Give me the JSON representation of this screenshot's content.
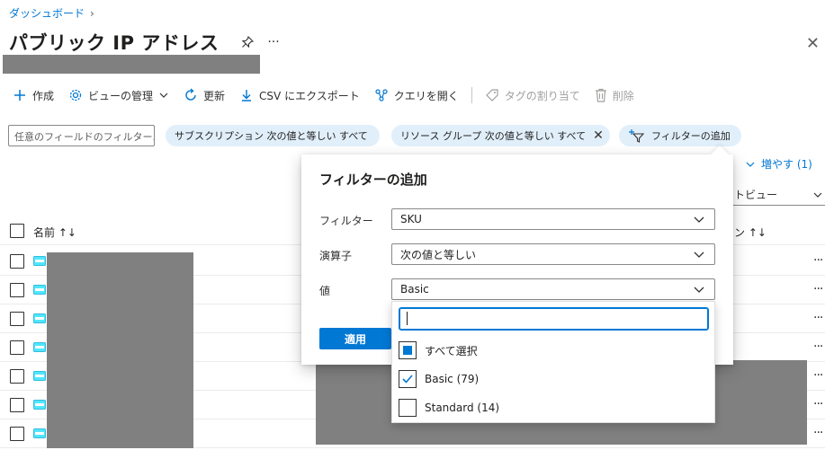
{
  "breadcrumb": {
    "item": "ダッシュボード",
    "separator": "›"
  },
  "page": {
    "title": "パブリック IP アドレス",
    "more": "···",
    "close": "✕"
  },
  "toolbar": {
    "create": "作成",
    "manage_view": "ビューの管理",
    "refresh": "更新",
    "export_csv": "CSV にエクスポート",
    "open_query": "クエリを開く",
    "assign_tags": "タグの割り当て",
    "delete": "削除"
  },
  "filters": {
    "search_placeholder": "任意のフィールドのフィルター...",
    "subscription_pill": "サブスクリプション 次の値と等しい すべて",
    "resource_group_pill": "リソース グループ 次の値と等しい すべて",
    "add_filter": "フィルターの追加",
    "expand_link": "増やす (1)",
    "view_label": "トビュー"
  },
  "table": {
    "name_header": "名前 ↑↓",
    "right_header": "ン ↑↓",
    "row_count": 7,
    "row_menu": "···"
  },
  "flyout": {
    "title": "フィルターの追加",
    "filter_label": "フィルター",
    "filter_value": "SKU",
    "operator_label": "演算子",
    "operator_value": "次の値と等しい",
    "value_label": "値",
    "value_value": "Basic",
    "apply": "適用"
  },
  "dropdown": {
    "search_value": "",
    "items": [
      {
        "label": "すべて選択",
        "state": "partial"
      },
      {
        "label": "Basic (79)",
        "state": "checked"
      },
      {
        "label": "Standard (14)",
        "state": "unchecked"
      }
    ]
  },
  "colors": {
    "accent": "#0078d4",
    "pill_bg": "#e1effa",
    "redaction": "#808080"
  }
}
